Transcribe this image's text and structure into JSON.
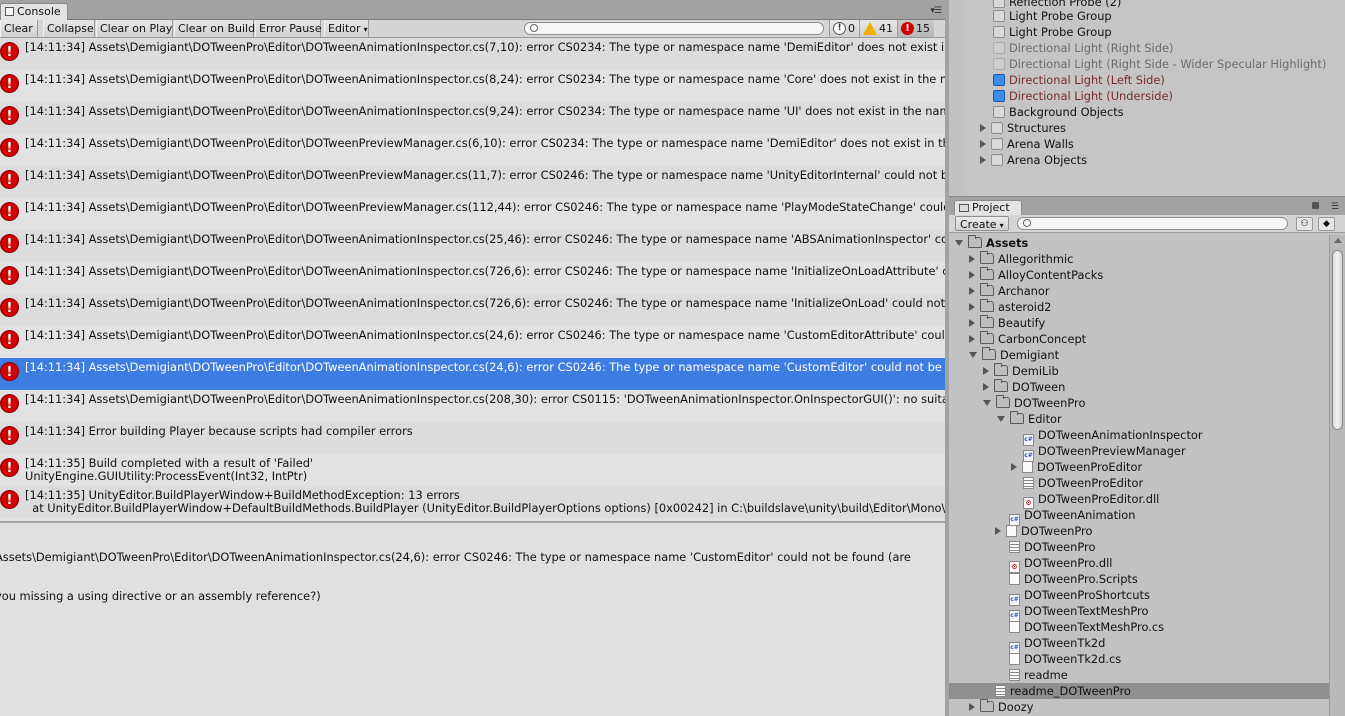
{
  "console": {
    "tab_label": "Console",
    "toolbar": {
      "clear": "Clear",
      "collapse": "Collapse",
      "clear_on_play": "Clear on Play",
      "clear_on_build": "Clear on Build",
      "error_pause": "Error Pause",
      "editor": "Editor"
    },
    "counts": {
      "info": "0",
      "warnings": "41",
      "errors": "15"
    },
    "messages": [
      {
        "text": "[14:11:34] Assets\\Demigiant\\DOTweenPro\\Editor\\DOTweenAnimationInspector.cs(7,10): error CS0234: The type or namespace name 'DemiEditor' does not exist in the namespace 'DG'"
      },
      {
        "text": "[14:11:34] Assets\\Demigiant\\DOTweenPro\\Editor\\DOTweenAnimationInspector.cs(8,24): error CS0234: The type or namespace name 'Core' does not exist in the namespace"
      },
      {
        "text": "[14:11:34] Assets\\Demigiant\\DOTweenPro\\Editor\\DOTweenAnimationInspector.cs(9,24): error CS0234: The type or namespace name 'UI' does not exist in the namespace"
      },
      {
        "text": "[14:11:34] Assets\\Demigiant\\DOTweenPro\\Editor\\DOTweenPreviewManager.cs(6,10): error CS0234: The type or namespace name 'DemiEditor' does not exist in the namespace"
      },
      {
        "text": "[14:11:34] Assets\\Demigiant\\DOTweenPro\\Editor\\DOTweenPreviewManager.cs(11,7): error CS0246: The type or namespace name 'UnityEditorInternal' could not be found"
      },
      {
        "text": "[14:11:34] Assets\\Demigiant\\DOTweenPro\\Editor\\DOTweenPreviewManager.cs(112,44): error CS0246: The type or namespace name 'PlayModeStateChange' could not be found"
      },
      {
        "text": "[14:11:34] Assets\\Demigiant\\DOTweenPro\\Editor\\DOTweenAnimationInspector.cs(25,46): error CS0246: The type or namespace name 'ABSAnimationInspector' could not be found"
      },
      {
        "text": "[14:11:34] Assets\\Demigiant\\DOTweenPro\\Editor\\DOTweenAnimationInspector.cs(726,6): error CS0246: The type or namespace name 'InitializeOnLoadAttribute' could not be found"
      },
      {
        "text": "[14:11:34] Assets\\Demigiant\\DOTweenPro\\Editor\\DOTweenAnimationInspector.cs(726,6): error CS0246: The type or namespace name 'InitializeOnLoad' could not be found"
      },
      {
        "text": "[14:11:34] Assets\\Demigiant\\DOTweenPro\\Editor\\DOTweenAnimationInspector.cs(24,6): error CS0246: The type or namespace name 'CustomEditorAttribute' could not be found"
      },
      {
        "text": "[14:11:34] Assets\\Demigiant\\DOTweenPro\\Editor\\DOTweenAnimationInspector.cs(24,6): error CS0246: The type or namespace name 'CustomEditor' could not be found",
        "selected": true
      },
      {
        "text": "[14:11:34] Assets\\Demigiant\\DOTweenPro\\Editor\\DOTweenAnimationInspector.cs(208,30): error CS0115: 'DOTweenAnimationInspector.OnInspectorGUI()': no suitable method found"
      },
      {
        "text": "[14:11:34] Error building Player because scripts had compiler errors"
      },
      {
        "text": "[14:11:35] Build completed with a result of 'Failed'\nUnityEngine.GUIUtility:ProcessEvent(Int32, IntPtr)"
      },
      {
        "text": "[14:11:35] UnityEditor.BuildPlayerWindow+BuildMethodException: 13 errors\n  at UnityEditor.BuildPlayerWindow+DefaultBuildMethods.BuildPlayer (UnityEditor.BuildPlayerOptions options) [0x00242] in C:\\buildslave\\unity\\build\\Editor\\Mono\\"
      }
    ],
    "detail_line1": "Assets\\Demigiant\\DOTweenPro\\Editor\\DOTweenAnimationInspector.cs(24,6): error CS0246: The type or namespace name 'CustomEditor' could not be found (are",
    "detail_line2": "you missing a using directive or an assembly reference?)"
  },
  "hierarchy": {
    "items": [
      {
        "label": "Reflection Probe (2)",
        "style": "normal"
      },
      {
        "label": "Light Probe Group",
        "style": "normal"
      },
      {
        "label": "Light Probe Group",
        "style": "normal"
      },
      {
        "label": "Directional Light (Right Side)",
        "style": "grey"
      },
      {
        "label": "Directional Light (Right Side - Wider Specular Highlight)",
        "style": "grey"
      },
      {
        "label": "Directional Light (Left Side)",
        "style": "red"
      },
      {
        "label": "Directional Light (Underside)",
        "style": "red"
      },
      {
        "label": "Background Objects",
        "style": "normal"
      },
      {
        "label": "Structures",
        "style": "group"
      },
      {
        "label": "Arena Walls",
        "style": "group"
      },
      {
        "label": "Arena Objects",
        "style": "group"
      }
    ]
  },
  "project": {
    "tab_label": "Project",
    "create_label": "Create",
    "tree": [
      {
        "label": "Assets"
      },
      {
        "label": "Allegorithmic"
      },
      {
        "label": "AlloyContentPacks"
      },
      {
        "label": "Archanor"
      },
      {
        "label": "asteroid2"
      },
      {
        "label": "Beautify"
      },
      {
        "label": "CarbonConcept"
      },
      {
        "label": "Demigiant"
      },
      {
        "label": "DemiLib"
      },
      {
        "label": "DOTween"
      },
      {
        "label": "DOTweenPro"
      },
      {
        "label": "Editor"
      },
      {
        "label": "DOTweenAnimationInspector"
      },
      {
        "label": "DOTweenPreviewManager"
      },
      {
        "label": "DOTweenProEditor"
      },
      {
        "label": "DOTweenProEditor"
      },
      {
        "label": "DOTweenProEditor.dll"
      },
      {
        "label": "DOTweenAnimation"
      },
      {
        "label": "DOTweenPro"
      },
      {
        "label": "DOTweenPro"
      },
      {
        "label": "DOTweenPro.dll"
      },
      {
        "label": "DOTweenPro.Scripts"
      },
      {
        "label": "DOTweenProShortcuts"
      },
      {
        "label": "DOTweenTextMeshPro"
      },
      {
        "label": "DOTweenTextMeshPro.cs"
      },
      {
        "label": "DOTweenTk2d"
      },
      {
        "label": "DOTweenTk2d.cs"
      },
      {
        "label": "readme"
      },
      {
        "label": "readme_DOTweenPro"
      },
      {
        "label": "Doozy"
      }
    ]
  }
}
